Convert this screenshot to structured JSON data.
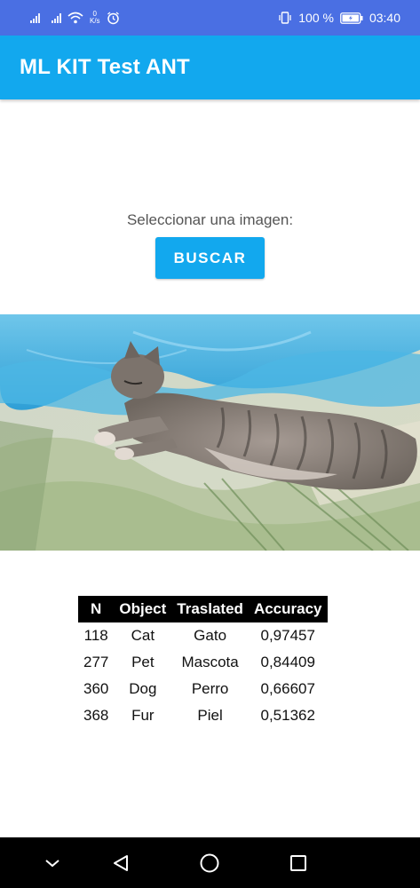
{
  "status_bar": {
    "net_speed_value": "0",
    "net_speed_unit": "K/s",
    "battery_percent": "100 %",
    "time": "03:40",
    "icons": [
      "signal-icon",
      "signal-icon",
      "wifi-icon",
      "alarm-icon",
      "vibrate-icon",
      "battery-icon"
    ]
  },
  "app_bar": {
    "title": "ML KIT Test ANT"
  },
  "main": {
    "prompt": "Seleccionar una imagen:",
    "search_button": "BUSCAR"
  },
  "results_table": {
    "headers": [
      "N",
      "Object",
      "Traslated",
      "Accuracy"
    ],
    "rows": [
      [
        "118",
        "Cat",
        "Gato",
        "0,97457"
      ],
      [
        "277",
        "Pet",
        "Mascota",
        "0,84409"
      ],
      [
        "360",
        "Dog",
        "Perro",
        "0,66607"
      ],
      [
        "368",
        "Fur",
        "Piel",
        "0,51362"
      ]
    ]
  },
  "nav_bar": {
    "buttons": [
      "back-chevron-icon",
      "back-icon",
      "home-icon",
      "recents-icon"
    ]
  },
  "colors": {
    "status_bar": "#4a6fe3",
    "app_bar": "#12a8ee",
    "button": "#12a8ee",
    "table_header": "#000000",
    "nav_bar": "#000000"
  }
}
